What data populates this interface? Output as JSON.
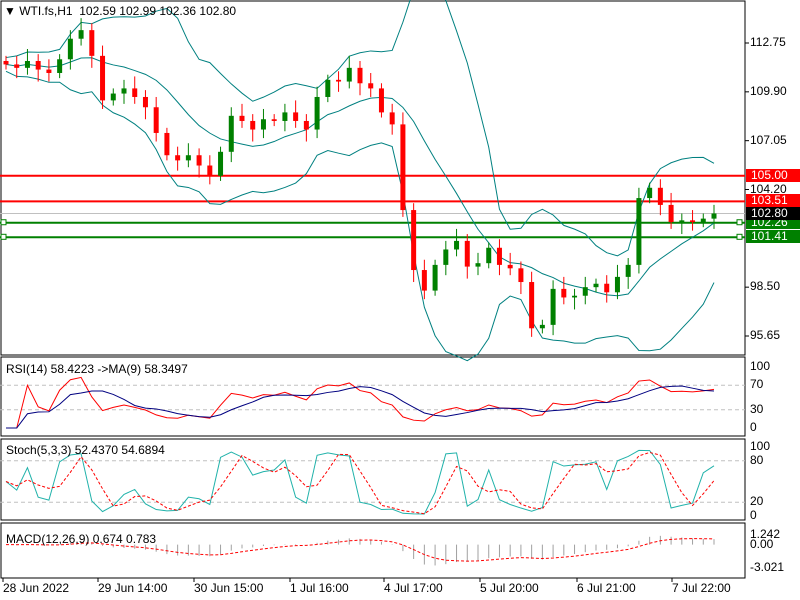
{
  "header": {
    "symbol": "WTI.fs,H1",
    "open": "102.59",
    "high": "102.99",
    "low": "102.36",
    "close": "102.80"
  },
  "colors": {
    "bull": "#008000",
    "bear": "#ff0000",
    "bands": "#008080",
    "resistance": "#ff0000",
    "support": "#008000"
  },
  "chart_data": [
    {
      "type": "candlestick",
      "title": "WTI.fs,H1",
      "closes": [
        111.5,
        111.3,
        111.7,
        111.2,
        111.0,
        111.8,
        113.0,
        113.5,
        112.0,
        109.4,
        109.8,
        110.1,
        109.6,
        109.0,
        107.5,
        106.2,
        105.9,
        106.2,
        105.6,
        105.0,
        106.4,
        108.5,
        108.2,
        107.7,
        108.3,
        108.2,
        108.7,
        108.2,
        107.7,
        109.6,
        110.6,
        110.5,
        111.3,
        110.4,
        110.1,
        108.7,
        108.0,
        103.0,
        99.5,
        98.3,
        99.8,
        100.7,
        101.2,
        99.7,
        99.9,
        100.8,
        99.8,
        99.6,
        98.8,
        96.1,
        96.3,
        98.4,
        97.9,
        98.0,
        98.5,
        98.7,
        98.2,
        99.1,
        99.8,
        103.7,
        104.3,
        103.3,
        102.3,
        102.4,
        102.3,
        102.5,
        102.8
      ],
      "ylim": [
        94.8,
        114.8
      ],
      "y_ticks": [
        "112.75",
        "109.90",
        "107.05",
        "104.20",
        "98.50",
        "95.65"
      ],
      "x_ticks": [
        "28 Jun 2022",
        "29 Jun 14:00",
        "30 Jun 15:00",
        "1 Jul 16:00",
        "4 Jul 17:00",
        "5 Jul 20:00",
        "6 Jul 21:00",
        "7 Jul 22:00"
      ],
      "levels": [
        {
          "value": 105.0,
          "label": "105.00",
          "kind": "resistance"
        },
        {
          "value": 103.51,
          "label": "103.51",
          "kind": "resistance"
        },
        {
          "value": 102.26,
          "label": "102.26",
          "kind": "support"
        },
        {
          "value": 101.41,
          "label": "101.41",
          "kind": "support"
        }
      ],
      "current_price": {
        "value": 102.8,
        "label": "102.80"
      },
      "indicator": "Bollinger Bands"
    },
    {
      "type": "line",
      "title": "RSI(14) 58.4223  ->MA(9) 58.3497",
      "ylim": [
        0,
        100
      ],
      "y_ticks": [
        "100",
        "70",
        "30",
        "0"
      ],
      "levels": [
        70,
        30
      ]
    },
    {
      "type": "line",
      "title": "Stoch(5,3,3) 52.4370 54.6894",
      "ylim": [
        0,
        100
      ],
      "y_ticks": [
        "100",
        "80",
        "20",
        "0"
      ],
      "levels": [
        80,
        20
      ]
    },
    {
      "type": "bar",
      "title": "MACD(12,26,9) 0.674 0.783",
      "ylim": [
        -3.021,
        1.242
      ],
      "y_ticks": [
        "1.242",
        "0.00",
        "-3.021"
      ]
    }
  ]
}
